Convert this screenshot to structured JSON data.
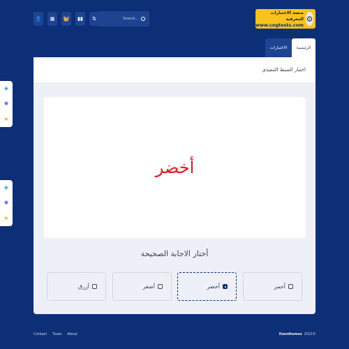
{
  "header": {
    "logo": {
      "line1": "منصة الاختبارات المعرفية",
      "line2": "www.cogtests.com"
    },
    "toolbar": [
      {
        "icon": "user-icon",
        "glyph": "👤"
      },
      {
        "icon": "grid-icon",
        "glyph": "▦"
      },
      {
        "icon": "basket-icon",
        "glyph": "🧺"
      },
      {
        "icon": "chart-icon",
        "glyph": "▮▮"
      },
      {
        "icon": "sort-icon",
        "glyph": "⇅"
      }
    ],
    "search": {
      "placeholder": "Search..."
    }
  },
  "tabs": [
    {
      "label": "الرئيسية",
      "active": true
    },
    {
      "label": "الاختبارات",
      "active": false
    }
  ],
  "subheader": {
    "title": "اختبار الضبط التنفيذي"
  },
  "question": {
    "word": "أخضر",
    "word_color": "#e11a1a"
  },
  "prompt": "أختار الاجابة الصحيحة",
  "options": [
    {
      "label": "أحمر",
      "selected": false
    },
    {
      "label": "أخضر",
      "selected": true
    },
    {
      "label": "أصفر",
      "selected": false
    },
    {
      "label": "أزرق",
      "selected": false
    }
  ],
  "side_widgets": [
    {
      "icons": [
        "layers-icon",
        "gear-icon",
        "send-icon"
      ]
    },
    {
      "icons": [
        "layers-icon",
        "gear-icon",
        "send-icon"
      ]
    }
  ],
  "footer": {
    "links": [
      "Contact",
      "Team",
      "About"
    ],
    "year": "2021©",
    "brand": "Keenthemes"
  },
  "colors": {
    "background": "#0c2f78",
    "accent": "#1e4491",
    "question_text": "#e11a1a"
  }
}
